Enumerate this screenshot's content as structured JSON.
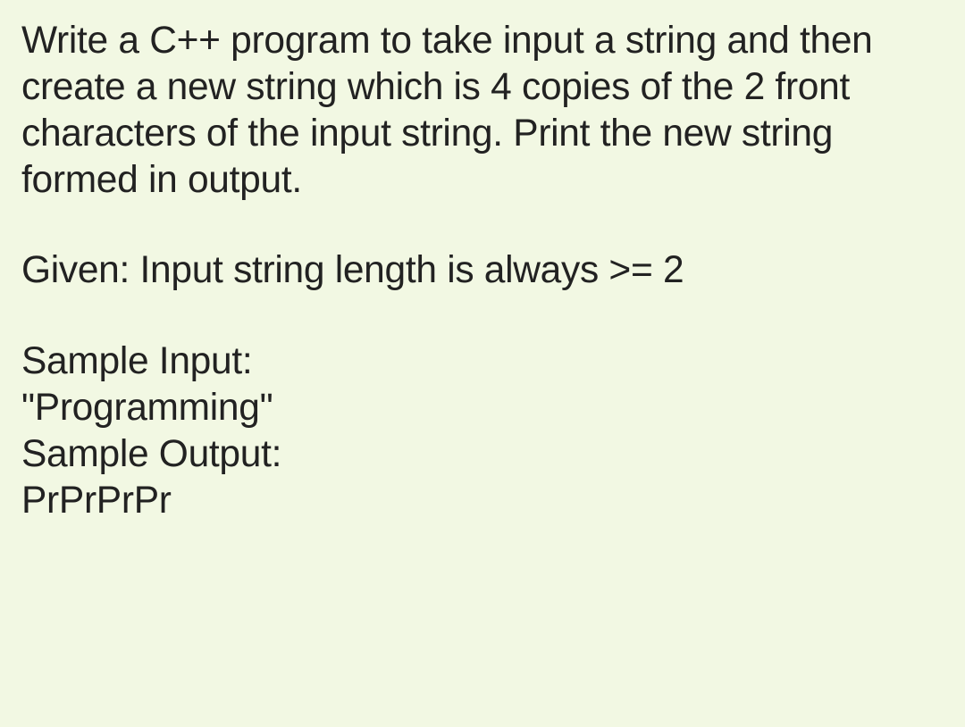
{
  "problem": {
    "description": "Write a C++ program to take input a string and then create a new string which is 4 copies of the 2 front characters of the input string. Print the new string formed in output.",
    "constraint": "Given: Input string length is always >= 2",
    "sampleInputLabel": "Sample Input:",
    "sampleInputValue": "\"Programming\"",
    "sampleOutputLabel": "Sample Output:",
    "sampleOutputValue": "PrPrPrPr"
  }
}
